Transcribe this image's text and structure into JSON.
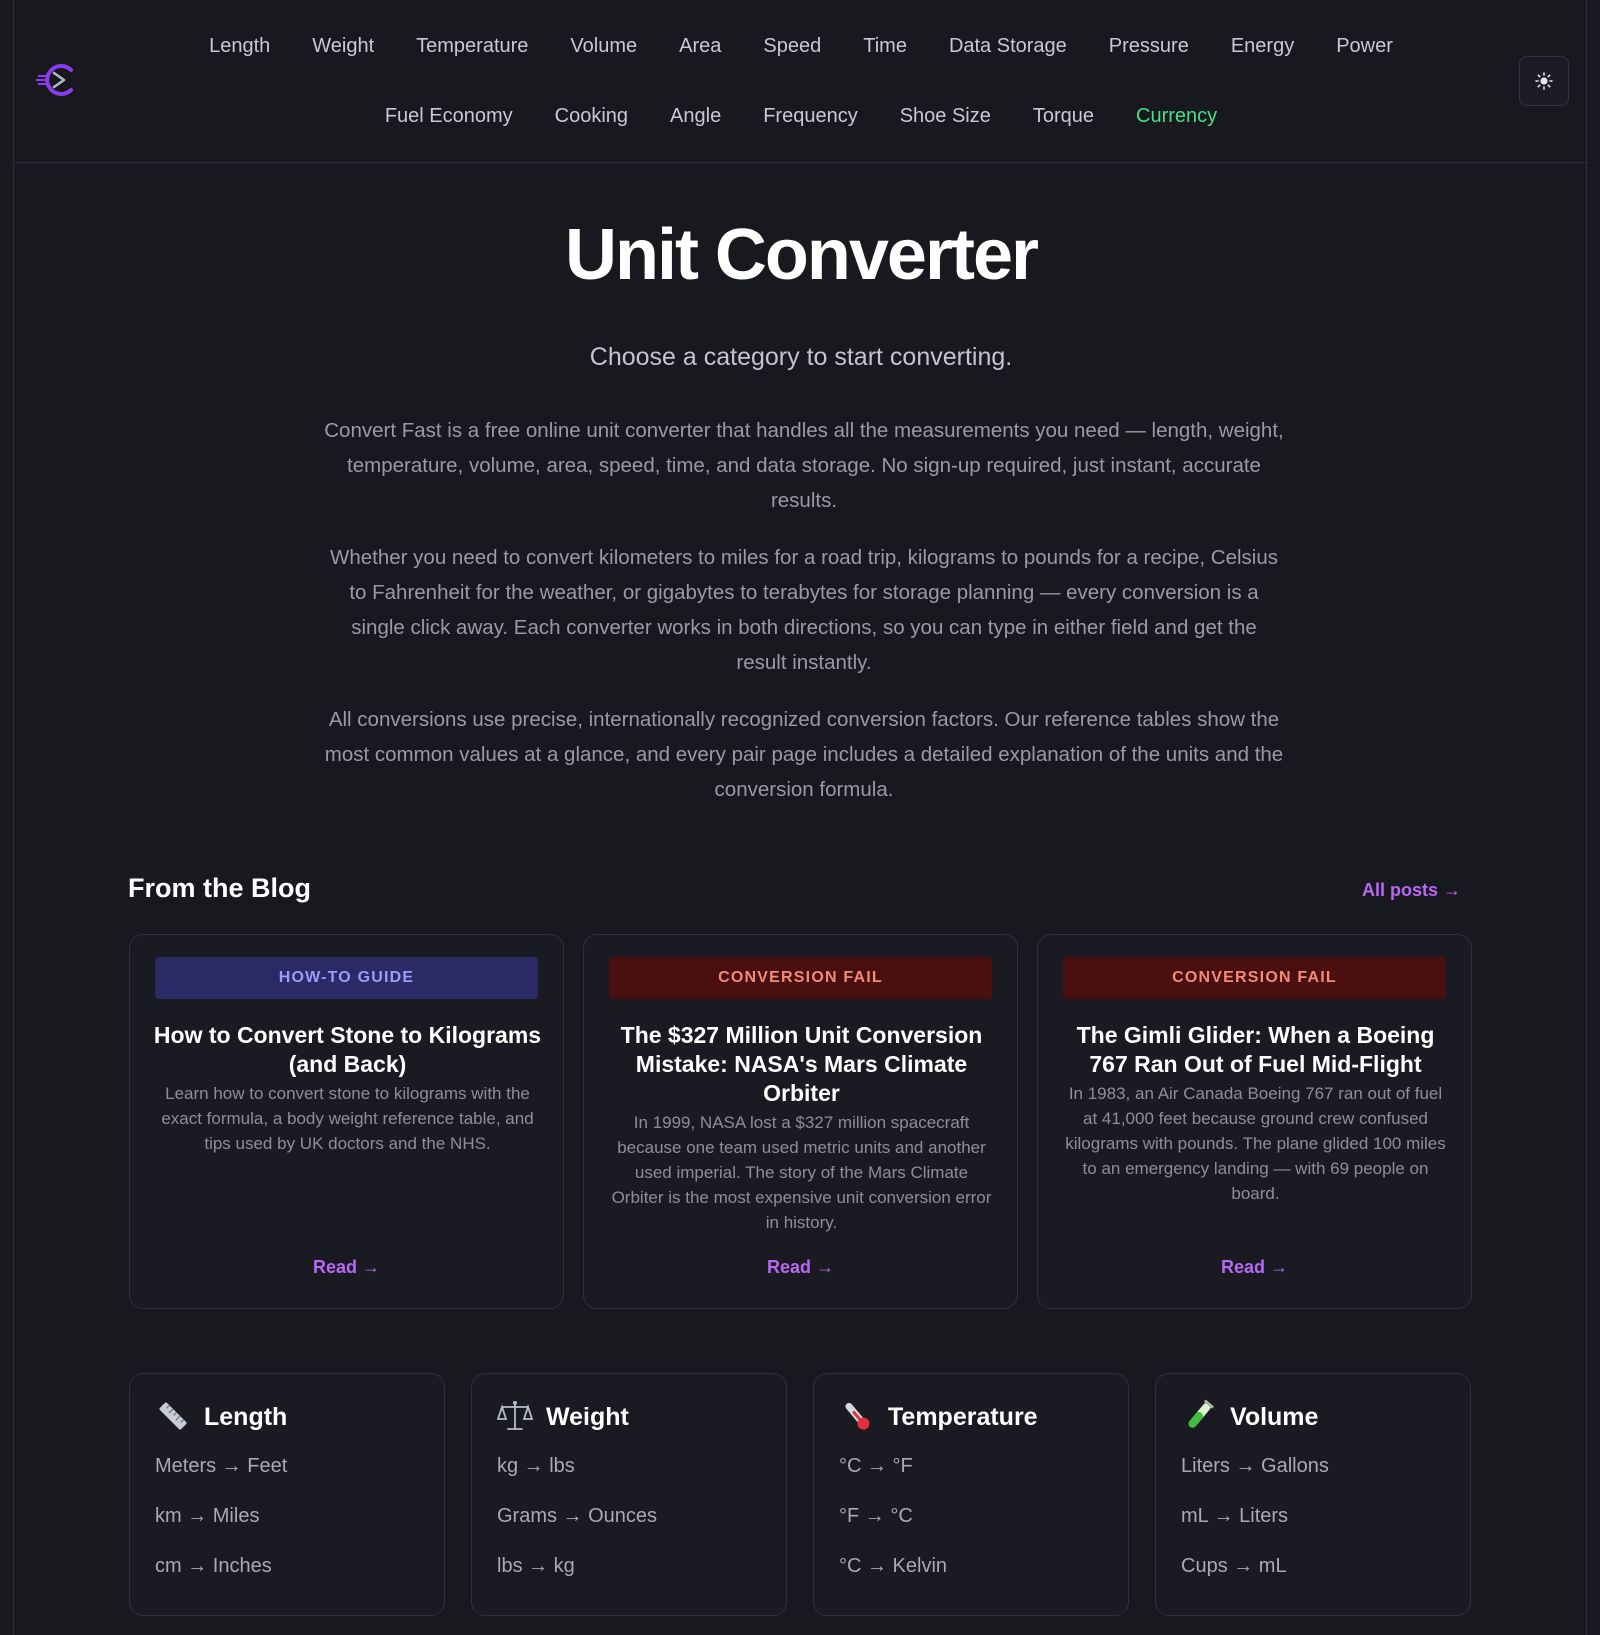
{
  "nav": {
    "row1": [
      "Length",
      "Weight",
      "Temperature",
      "Volume",
      "Area",
      "Speed",
      "Time",
      "Data Storage",
      "Pressure",
      "Energy",
      "Power"
    ],
    "row2": [
      "Fuel Economy",
      "Cooking",
      "Angle",
      "Frequency",
      "Shoe Size",
      "Torque",
      "Currency"
    ],
    "active": "Currency",
    "theme_icon": "sun-icon"
  },
  "hero": {
    "title": "Unit Converter",
    "subtitle": "Choose a category to start converting.",
    "paragraphs": [
      "Convert Fast is a free online unit converter that handles all the measurements you need — length, weight, temperature, volume, area, speed, time, and data storage. No sign-up required, just instant, accurate results.",
      "Whether you need to convert kilometers to miles for a road trip, kilograms to pounds for a recipe, Celsius to Fahrenheit for the weather, or gigabytes to terabytes for storage planning — every conversion is a single click away. Each converter works in both directions, so you can type in either field and get the result instantly.",
      "All conversions use precise, internationally recognized conversion factors. Our reference tables show the most common values at a glance, and every pair page includes a detailed explanation of the units and the conversion formula."
    ]
  },
  "blog": {
    "heading": "From the Blog",
    "all_posts": "All posts →",
    "posts": [
      {
        "tag": "HOW-TO GUIDE",
        "title": "How to Convert Stone to Kilograms (and Back)",
        "desc": "Learn how to convert stone to kilograms with the exact formula, a body weight reference table, and tips used by UK doctors and the NHS.",
        "read": "Read →"
      },
      {
        "tag": "CONVERSION FAIL",
        "title": "The $327 Million Unit Conversion Mistake: NASA's Mars Climate Orbiter",
        "desc": "In 1999, NASA lost a $327 million spacecraft because one team used metric units and another used imperial. The story of the Mars Climate Orbiter is the most expensive unit conversion error in history.",
        "read": "Read →"
      },
      {
        "tag": "CONVERSION FAIL",
        "title": "The Gimli Glider: When a Boeing 767 Ran Out of Fuel Mid-Flight",
        "desc": "In 1983, an Air Canada Boeing 767 ran out of fuel at 41,000 feet because ground crew confused kilograms with pounds. The plane glided 100 miles to an emergency landing — with 69 people on board.",
        "read": "Read →"
      }
    ]
  },
  "categories": [
    {
      "icon": "ruler-icon",
      "title": "Length",
      "links": [
        "Meters → Feet",
        "km → Miles",
        "cm → Inches"
      ]
    },
    {
      "icon": "scale-icon",
      "title": "Weight",
      "links": [
        "kg → lbs",
        "Grams → Ounces",
        "lbs → kg"
      ]
    },
    {
      "icon": "thermometer-icon",
      "title": "Temperature",
      "links": [
        "°C → °F",
        "°F → °C",
        "°C → Kelvin"
      ]
    },
    {
      "icon": "test-tube-icon",
      "title": "Volume",
      "links": [
        "Liters → Gallons",
        "mL → Liters",
        "Cups → mL"
      ]
    }
  ],
  "colors": {
    "background": "#18191f",
    "accent": "#b768f5",
    "active_nav": "#4ade80",
    "howto_tag_bg": "#2b2a67",
    "fail_tag_bg": "#4a1010"
  }
}
